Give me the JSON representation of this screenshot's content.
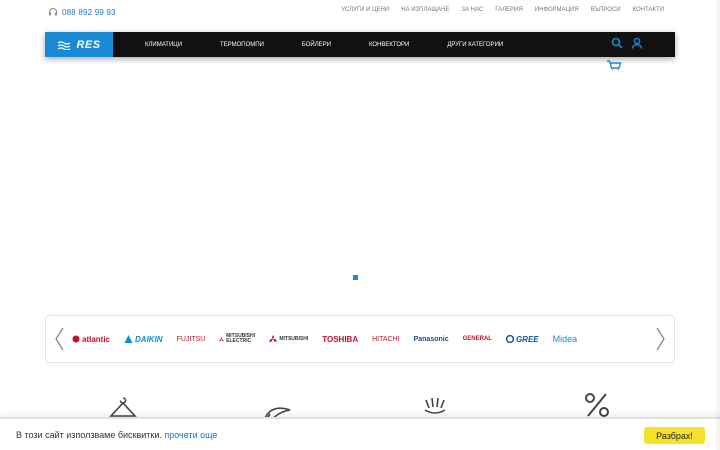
{
  "topbar": {
    "phone": "088 892 99 93",
    "links": [
      "УСЛУГИ И ЦЕНИ",
      "НА ИЗПЛАЩАНЕ",
      "ЗА НАС",
      "ГАЛЕРИЯ",
      "ИНФОРМАЦИЯ",
      "ВЪПРОСИ",
      "КОНТАКТИ"
    ]
  },
  "nav": {
    "logo": "RES",
    "items": [
      "КЛИМАТИЦИ",
      "ТЕРМОПОМПИ",
      "БОЙЛЕРИ",
      "КОНВЕКТОРИ",
      "ДРУГИ КАТЕГОРИИ"
    ],
    "icons": [
      "search-icon",
      "user-icon",
      "cart-icon"
    ]
  },
  "slider": {
    "active_index": 0,
    "total": 1
  },
  "brands": {
    "items": [
      "atlantic",
      "DAIKIN",
      "FUJITSU",
      "MITSUBISHI ELECTRIC",
      "MITSUBISHI",
      "TOSHIBA",
      "HITACHI",
      "Panasonic",
      "GENERAL",
      "GREE",
      "Midea"
    ]
  },
  "features": {
    "icons": [
      "hanger-icon",
      "rocket-icon",
      "hands-icon",
      "percent-icon"
    ]
  },
  "cookie": {
    "text": "В този сайт използваме бисквитки.",
    "link": "прочети още",
    "button": "Разбрах!"
  },
  "colors": {
    "accent": "#1b8ad6",
    "nav_bg": "#111111",
    "cookie_button": "#f5e12c"
  }
}
